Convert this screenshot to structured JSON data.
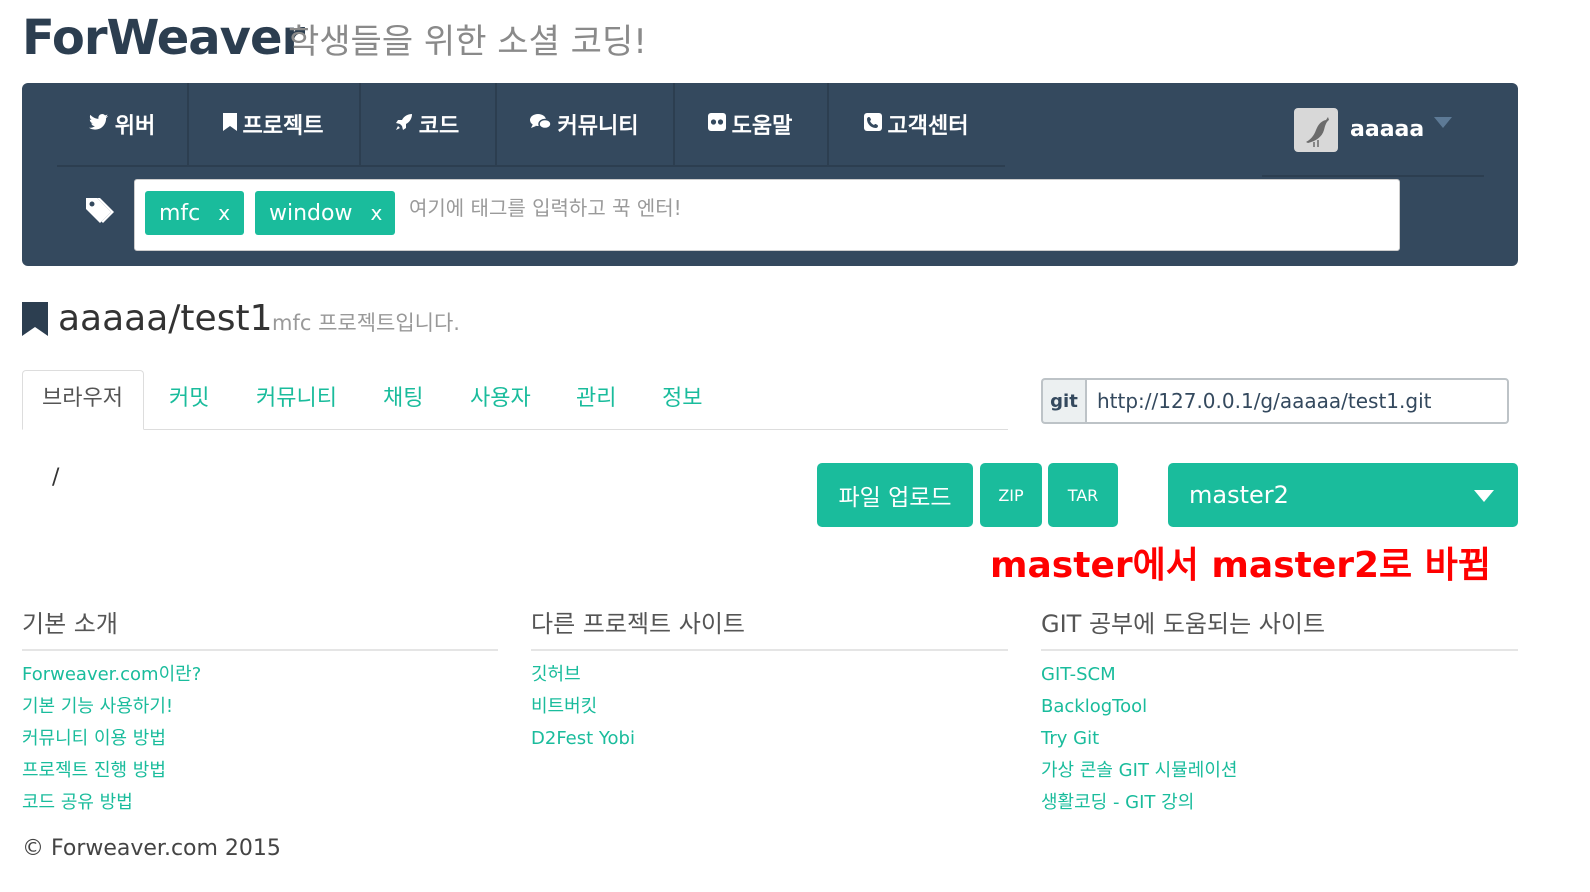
{
  "header": {
    "brand": "ForWeaver",
    "tagline": "학생들을 위한 소셜 코딩!"
  },
  "nav": {
    "items": [
      {
        "label": "위버",
        "icon": "twitter-bird-icon"
      },
      {
        "label": "프로젝트",
        "icon": "bookmark-icon"
      },
      {
        "label": "코드",
        "icon": "rocket-icon"
      },
      {
        "label": "커뮤니티",
        "icon": "comments-icon"
      },
      {
        "label": "도움말",
        "icon": "flickr-icon"
      },
      {
        "label": "고객센터",
        "icon": "phone-icon"
      }
    ],
    "user": {
      "name": "aaaaa"
    }
  },
  "tags": {
    "chips": [
      {
        "label": "mfc",
        "remove": "x"
      },
      {
        "label": "window",
        "remove": "x"
      }
    ],
    "placeholder": "여기에 태그를 입력하고 꾹 엔터!"
  },
  "project": {
    "title": "aaaaa/test1",
    "description": "mfc 프로젝트입니다."
  },
  "tabs": [
    "브라우저",
    "커밋",
    "커뮤니티",
    "채팅",
    "사용자",
    "관리",
    "정보"
  ],
  "git": {
    "addon": "git",
    "url": "http://127.0.0.1/g/aaaaa/test1.git"
  },
  "browser": {
    "path": "/",
    "upload_label": "파일 업로드",
    "zip_label": "ZIP",
    "tar_label": "TAR",
    "branch": "master2"
  },
  "annotation": "master에서 master2로 바뀜",
  "footer": {
    "columns": [
      {
        "title": "기본 소개",
        "links": [
          "Forweaver.com이란?",
          "기본 기능 사용하기!",
          "커뮤니티 이용 방법",
          "프로젝트 진행 방법",
          "코드 공유 방법"
        ]
      },
      {
        "title": "다른 프로젝트 사이트",
        "links": [
          "깃허브",
          "비트버킷",
          "D2Fest Yobi"
        ]
      },
      {
        "title": "GIT 공부에 도움되는 사이트",
        "links": [
          "GIT-SCM",
          "BacklogTool",
          "Try Git",
          "가상 콘솔 GIT 시뮬레이션",
          "생활코딩 - GIT 강의"
        ]
      }
    ],
    "copyright": "© Forweaver.com 2015"
  },
  "colors": {
    "accent": "#1abc9c",
    "navbar": "#34495e",
    "annotation": "#ff0000"
  }
}
